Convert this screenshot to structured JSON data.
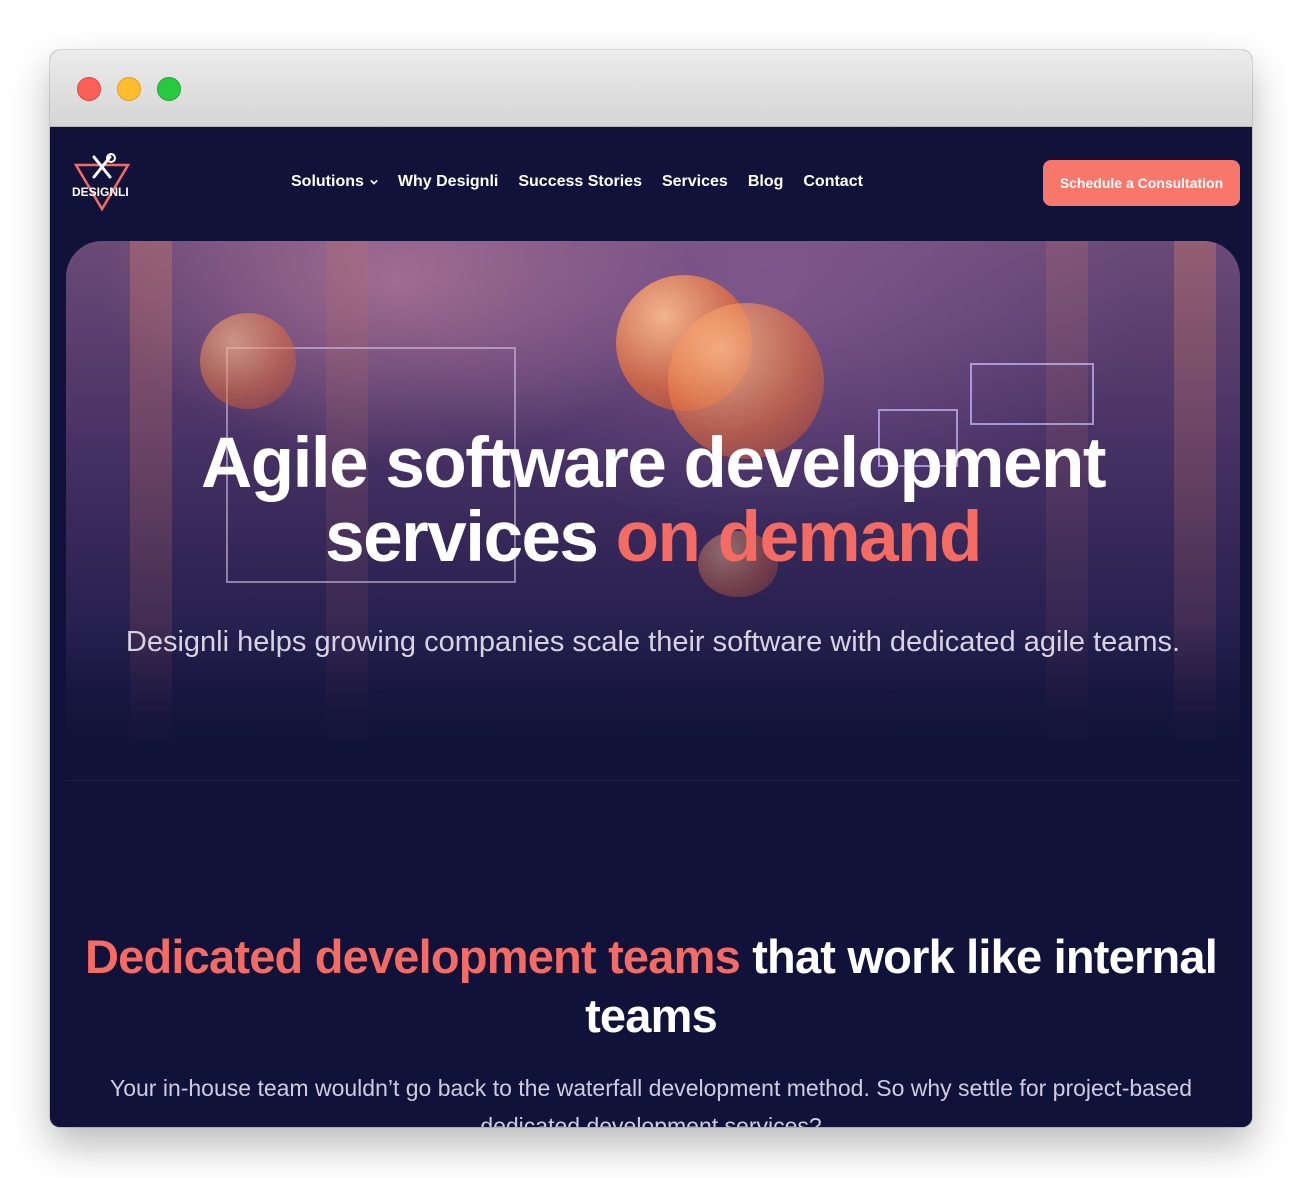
{
  "window": {
    "controls": [
      "close",
      "minimize",
      "maximize"
    ]
  },
  "header": {
    "logo_text": "DESIGNLI",
    "nav": [
      {
        "label": "Solutions",
        "has_dropdown": true
      },
      {
        "label": "Why Designli"
      },
      {
        "label": "Success Stories"
      },
      {
        "label": "Services"
      },
      {
        "label": "Blog"
      },
      {
        "label": "Contact"
      }
    ],
    "cta_label": "Schedule a Consultation"
  },
  "hero": {
    "title_line1": "Agile software development",
    "title_line2_plain": "services ",
    "title_line2_accent": "on demand",
    "subtitle": "Designli helps growing companies scale their software with dedicated agile teams."
  },
  "section": {
    "heading_accent": "Dedicated development teams",
    "heading_plain": " that work like internal teams",
    "body": "Your in-house team wouldn’t go back to the waterfall development method. So why settle for project-based dedicated development services?"
  },
  "colors": {
    "background": "#11123a",
    "accent": "#f36b63",
    "cta": "#f7786b"
  }
}
